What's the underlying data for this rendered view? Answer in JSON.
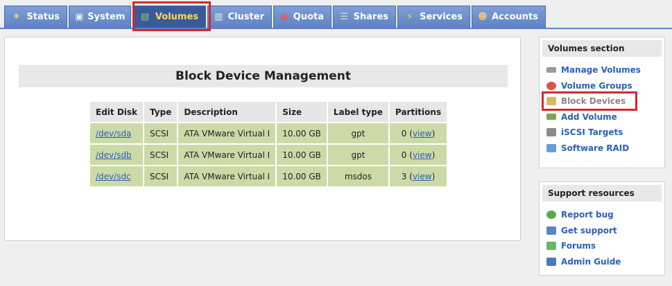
{
  "tabs": [
    {
      "label": "Status",
      "icon": "sun-icon",
      "active": false
    },
    {
      "label": "System",
      "icon": "monitor-icon",
      "active": false
    },
    {
      "label": "Volumes",
      "icon": "disk-icon",
      "active": true
    },
    {
      "label": "Cluster",
      "icon": "cluster-icon",
      "active": false
    },
    {
      "label": "Quota",
      "icon": "pie-icon",
      "active": false
    },
    {
      "label": "Shares",
      "icon": "shares-icon",
      "active": false
    },
    {
      "label": "Services",
      "icon": "lightning-icon",
      "active": false
    },
    {
      "label": "Accounts",
      "icon": "users-icon",
      "active": false
    }
  ],
  "main": {
    "title": "Block Device Management",
    "columns": [
      "Edit Disk",
      "Type",
      "Description",
      "Size",
      "Label type",
      "Partitions"
    ],
    "rows": [
      {
        "disk": "/dev/sda",
        "type": "SCSI",
        "description": "ATA VMware Virtual I",
        "size": "10.00 GB",
        "label_type": "gpt",
        "partitions_count": "0 (",
        "partitions_link": "view",
        "partitions_end": ")"
      },
      {
        "disk": "/dev/sdb",
        "type": "SCSI",
        "description": "ATA VMware Virtual I",
        "size": "10.00 GB",
        "label_type": "gpt",
        "partitions_count": "0 (",
        "partitions_link": "view",
        "partitions_end": ")"
      },
      {
        "disk": "/dev/sdc",
        "type": "SCSI",
        "description": "ATA VMware Virtual I",
        "size": "10.00 GB",
        "label_type": "msdos",
        "partitions_count": "3 (",
        "partitions_link": "view",
        "partitions_end": ")"
      }
    ]
  },
  "sidebar": {
    "volumes_section": {
      "title": "Volumes section",
      "items": [
        {
          "label": "Manage Volumes",
          "icon": "drive-icon"
        },
        {
          "label": "Volume Groups",
          "icon": "group-icon"
        },
        {
          "label": "Block Devices",
          "icon": "block-device-icon"
        },
        {
          "label": "Add Volume",
          "icon": "add-drive-icon"
        },
        {
          "label": "iSCSI Targets",
          "icon": "iscsi-icon"
        },
        {
          "label": "Software RAID",
          "icon": "raid-icon"
        }
      ]
    },
    "support": {
      "title": "Support resources",
      "items": [
        {
          "label": "Report bug",
          "icon": "bug-icon"
        },
        {
          "label": "Get support",
          "icon": "support-icon"
        },
        {
          "label": "Forums",
          "icon": "forums-icon"
        },
        {
          "label": "Admin Guide",
          "icon": "book-icon"
        }
      ]
    }
  },
  "colors": {
    "tab": "#6b8ccb",
    "tab_active": "#3b5a9a",
    "tab_active_text": "#ffd75a",
    "row_bg": "#ccdaa8",
    "link": "#2b5fb8",
    "highlight": "#d6262c"
  }
}
